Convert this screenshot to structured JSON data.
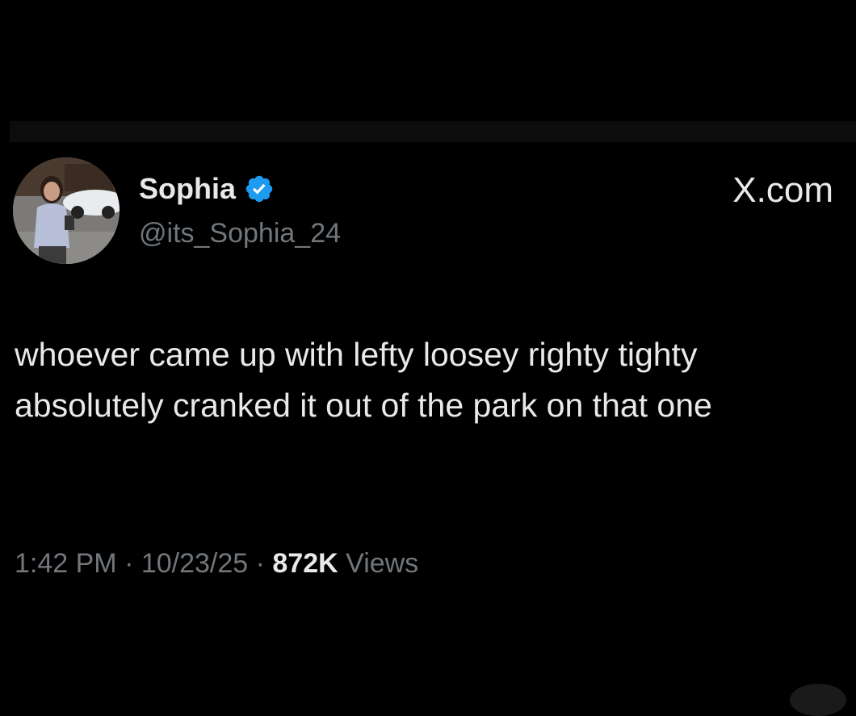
{
  "top_area": {},
  "author": {
    "display_name": "Sophia",
    "handle": "@its_Sophia_24",
    "verified_icon": "verified-badge-icon",
    "avatar_icon": "avatar-photo"
  },
  "site": {
    "label": "X.com"
  },
  "tweet": {
    "text": "whoever came up with lefty loosey righty tighty absolutely cranked it out of the park on that one"
  },
  "meta": {
    "time": "1:42 PM",
    "separator_1": " · ",
    "date": "10/23/25",
    "separator_2": " · ",
    "views_count": "872K",
    "views_label": " Views"
  },
  "colors": {
    "background": "#000000",
    "text_primary": "#e7e9ea",
    "text_secondary": "#71767b",
    "verified_blue": "#1d9bf0"
  }
}
